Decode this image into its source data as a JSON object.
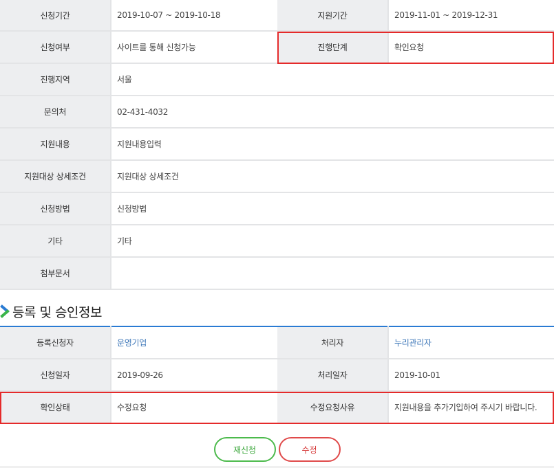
{
  "info_table": {
    "rows": [
      {
        "label": "신청기간",
        "value": "2019-10-07 ~ 2019-10-18",
        "label2": "지원기간",
        "value2": "2019-11-01 ~ 2019-12-31"
      },
      {
        "label": "신청여부",
        "value": "사이트를 통해 신청가능",
        "label2": "진행단계",
        "value2": "확인요청"
      },
      {
        "label": "진행지역",
        "value": "서울"
      },
      {
        "label": "문의처",
        "value": "02-431-4032"
      },
      {
        "label": "지원내용",
        "value": "지원내용입력"
      },
      {
        "label": "지원대상 상세조건",
        "value": "지원대상 상세조건"
      },
      {
        "label": "신청방법",
        "value": "신청방법"
      },
      {
        "label": "기타",
        "value": "기타"
      },
      {
        "label": "첨부문서",
        "value": ""
      }
    ]
  },
  "registration_section": {
    "title": "등록 및 승인정보",
    "icon": "chevron-right-icon",
    "rows": [
      {
        "label": "등록신청자",
        "value": "운영기업",
        "label2": "처리자",
        "value2": "누리관리자"
      },
      {
        "label": "신청일자",
        "value": "2019-09-26",
        "label2": "처리일자",
        "value2": "2019-10-01"
      },
      {
        "label": "확인상태",
        "value": "수정요청",
        "label2": "수정요청사유",
        "value2": "지원내용을 추가기입하여 주시기 바랍니다."
      }
    ]
  },
  "buttons": {
    "reapply_label": "재신청",
    "edit_label": "수정"
  },
  "colors": {
    "header_bg": "#edeef0",
    "link_blue": "#3c76b8",
    "section_border_blue": "#2a7bd3",
    "highlight_red": "#e52a2a",
    "button_green": "#4cba4c",
    "button_red": "#e04a4a"
  }
}
